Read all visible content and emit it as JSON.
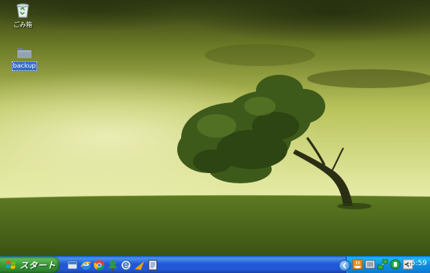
{
  "desktop": {
    "icons": [
      {
        "name": "recycle-bin",
        "label": "ごみ箱",
        "icon": "recycle-bin-icon",
        "selected": false
      },
      {
        "name": "backup-folder",
        "label": "backup",
        "icon": "folder-icon",
        "selected": true
      }
    ]
  },
  "taskbar": {
    "start_label": "スタート",
    "quick_launch": [
      {
        "icon": "show-desktop-icon"
      },
      {
        "icon": "internet-explorer-icon"
      },
      {
        "icon": "chrome-icon"
      },
      {
        "icon": "tree-app-icon"
      },
      {
        "icon": "browser-e-icon"
      },
      {
        "icon": "winamp-icon"
      },
      {
        "icon": "notepad-icon"
      }
    ],
    "tray": {
      "icons": [
        {
          "icon": "show-hidden-icons-arrow"
        },
        {
          "icon": "java-icon"
        },
        {
          "icon": "ime-icon"
        },
        {
          "icon": "network-icon"
        },
        {
          "icon": "safely-remove-icon"
        },
        {
          "icon": "volume-icon"
        }
      ],
      "clock": "15:59"
    }
  },
  "colors": {
    "taskbar_blue": "#2157d7",
    "start_green": "#3a9a3a",
    "tray_blue": "#0d8ddd",
    "selection_blue": "#316ac5"
  }
}
